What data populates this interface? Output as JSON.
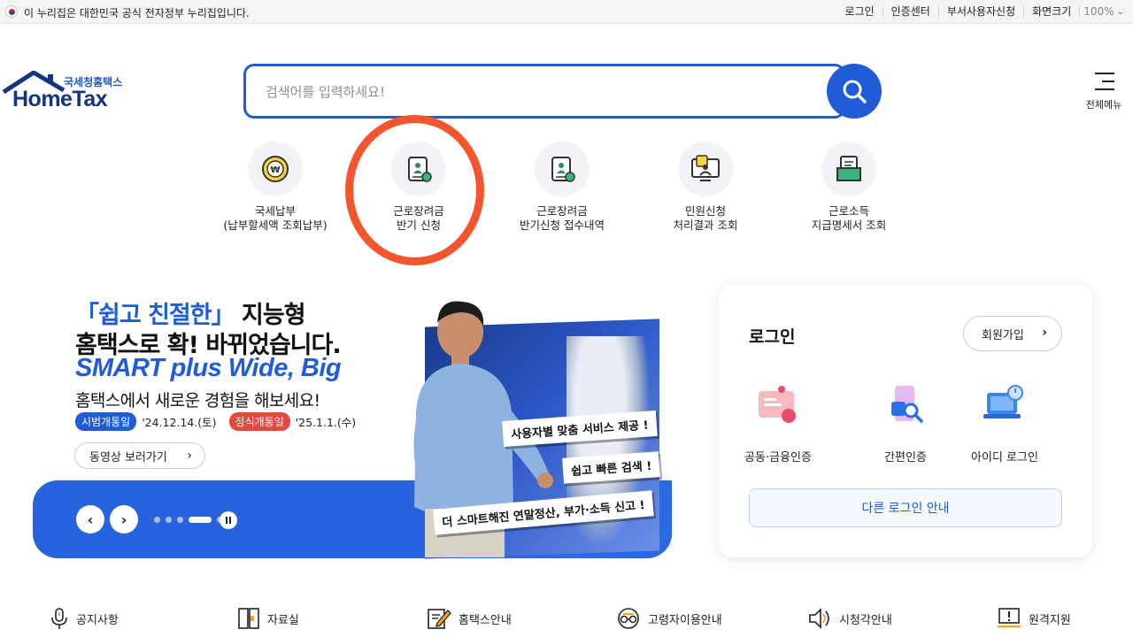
{
  "gov_bar": {
    "notice": "이 누리집은 대한민국 공식 전자정부 누리집입니다.",
    "links": [
      "로그인",
      "인증센터",
      "부서사용자신청",
      "화면크기"
    ],
    "zoom": "100%"
  },
  "header": {
    "logo_kr": "국세청홈택스",
    "logo_en": "HomeTax",
    "search_placeholder": "검색어를 입력하세요!",
    "all_menu_label": "전체메뉴"
  },
  "quick_menu": [
    {
      "line1": "국세납부",
      "line2": "(납부할세액 조회납부)",
      "icon": "won-coin-icon"
    },
    {
      "line1": "근로장려금",
      "line2": "반기 신청",
      "icon": "document-person-icon"
    },
    {
      "line1": "근로장려금",
      "line2": "반기신청 접수내역",
      "icon": "document-person-icon"
    },
    {
      "line1": "민원신청",
      "line2": "처리결과 조회",
      "icon": "monitor-person-icon"
    },
    {
      "line1": "근로소득",
      "line2": "지급명세서 조회",
      "icon": "folder-doc-icon"
    }
  ],
  "hero": {
    "line1_accent": "「쉽고 친절한」",
    "line1_rest": " 지능형",
    "line2": "홈택스로 확! 바뀌었습니다.",
    "line3": "SMART plus Wide, Big",
    "sub": "홈택스에서 새로운 경험을 해보세요!",
    "trial_label": "시범개통일",
    "trial_date": "'24.12.14.(토)",
    "launch_label": "정식개통일",
    "launch_date": "'25.1.1.(수)",
    "video_button": "동영상 보러가기",
    "bubbles": [
      "사용자별 맞춤 서비스 제공 !",
      "쉽고 빠른 검색 !",
      "더 스마트해진 연말정산, 부가·소득 신고 !"
    ],
    "prev": "‹",
    "next": "›",
    "slide_count": 5,
    "active_slide": 4
  },
  "login": {
    "title": "로그인",
    "join_button": "회원가입",
    "options": [
      {
        "label": "공동·금융인증",
        "icon": "certificate-card-icon"
      },
      {
        "label": "간편인증",
        "icon": "phone-search-icon"
      },
      {
        "label": "아이디 로그인",
        "icon": "laptop-power-icon"
      }
    ],
    "other_login": "다른 로그인 안내"
  },
  "bottom_menu": [
    {
      "label": "공지사항",
      "icon": "microphone-icon"
    },
    {
      "label": "자료실",
      "icon": "binder-icon"
    },
    {
      "label": "홈택스안내",
      "icon": "notepad-pen-icon"
    },
    {
      "label": "고령자이용안내",
      "icon": "glasses-circle-icon"
    },
    {
      "label": "시청각안내",
      "icon": "speaker-icon"
    },
    {
      "label": "원격지원",
      "icon": "monitor-alert-icon"
    }
  ],
  "colors": {
    "primary": "#1f5cd6",
    "highlight_circle": "#f4552c",
    "badge_red": "#e5483f"
  }
}
